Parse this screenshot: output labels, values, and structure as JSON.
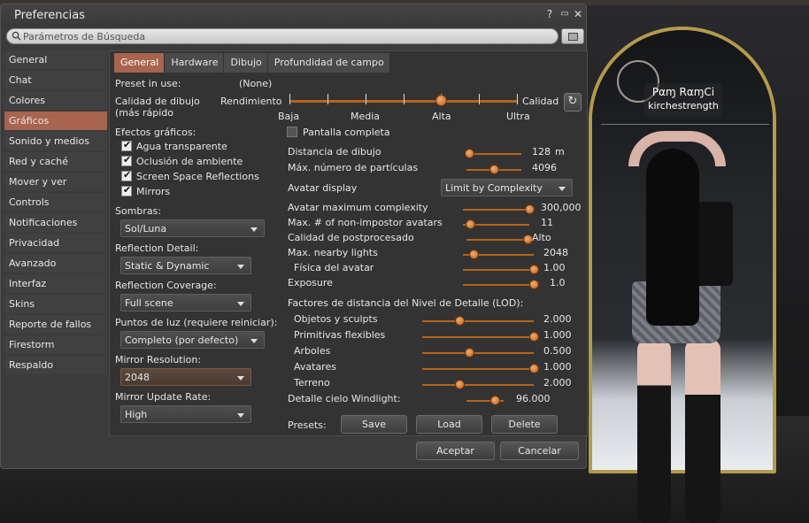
{
  "window": {
    "title": "Preferencias",
    "help_icon": "?",
    "minimize_icon": "▭",
    "close_icon": "✕"
  },
  "search": {
    "placeholder": "Parámetros de Búsqueda"
  },
  "sidebar": {
    "items": [
      {
        "label": "General"
      },
      {
        "label": "Chat"
      },
      {
        "label": "Colores"
      },
      {
        "label": "Gráficos"
      },
      {
        "label": "Sonido y medios"
      },
      {
        "label": "Red y caché"
      },
      {
        "label": "Mover y ver"
      },
      {
        "label": "Controls"
      },
      {
        "label": "Notificaciones"
      },
      {
        "label": "Privacidad"
      },
      {
        "label": "Avanzado"
      },
      {
        "label": "Interfaz"
      },
      {
        "label": "Skins"
      },
      {
        "label": "Reporte de fallos"
      },
      {
        "label": "Firestorm"
      },
      {
        "label": "Respaldo"
      }
    ],
    "active_index": 3
  },
  "tabs": [
    {
      "label": "General"
    },
    {
      "label": "Hardware"
    },
    {
      "label": "Dibujo"
    },
    {
      "label": "Profundidad de campo"
    }
  ],
  "general": {
    "preset_label": "Preset in use:",
    "preset_value": "(None)",
    "quality_label_1": "Calidad de dibujo",
    "quality_label_2": "(más rápido",
    "perf_label": "Rendimiento",
    "quality_end_label": "Calidad",
    "quality_ticks": {
      "t0": "Baja",
      "t1": "Media",
      "t2": "Alta",
      "t3": "Ultra"
    },
    "quality_level": 5,
    "quality_max": 7,
    "effects_label": "Efectos gráficos:",
    "checkboxes": [
      {
        "label": "Agua transparente",
        "checked": true
      },
      {
        "label": "Oclusión de ambiente",
        "checked": true
      },
      {
        "label": "Screen Space Reflections",
        "checked": true
      },
      {
        "label": "Mirrors",
        "checked": true
      }
    ],
    "fullscreen": {
      "label": "Pantalla completa",
      "checked": false
    },
    "shadows_label": "Sombras:",
    "shadows_value": "Sol/Luna",
    "reflection_detail_label": "Reflection Detail:",
    "reflection_detail_value": "Static & Dynamic",
    "reflection_coverage_label": "Reflection Coverage:",
    "reflection_coverage_value": "Full scene",
    "lights_label": "Puntos de luz (requiere reiniciar):",
    "lights_value": "Completo (por defecto)",
    "mirror_res_label": "Mirror Resolution:",
    "mirror_res_value": "2048",
    "mirror_rate_label": "Mirror Update Rate:",
    "mirror_rate_value": "High",
    "draw_distance": {
      "label": "Distancia de dibujo",
      "value": "128",
      "unit": "m",
      "fraction": 0.05
    },
    "max_particles": {
      "label": "Máx. número de partículas",
      "value": "4096",
      "fraction": 0.5
    },
    "avatar_display": {
      "label": "Avatar display",
      "value": "Limit by Complexity"
    },
    "avatar_complexity": {
      "label": "Avatar maximum complexity",
      "value": "300,000",
      "fraction": 1.0
    },
    "non_impostor": {
      "label": "Max. # of non-impostor avatars",
      "value": "11",
      "fraction": 0.1
    },
    "postprocess": {
      "label": "Calidad de postprocesado",
      "value": "Alto",
      "fraction": 1.0
    },
    "nearby_lights": {
      "label": "Max. nearby lights",
      "value": "2048",
      "fraction": 0.15
    },
    "avatar_physics": {
      "label": "Física del avatar",
      "value": "1.00",
      "fraction": 1.0
    },
    "exposure": {
      "label": "Exposure",
      "value": "1.0",
      "fraction": 1.0
    },
    "lod_label": "Factores de distancia del Nivel de Detalle (LOD):",
    "lod": [
      {
        "label": "Objetos y sculpts",
        "value": "2.000",
        "fraction": 0.33
      },
      {
        "label": "Primitivas flexibles",
        "value": "1.000",
        "fraction": 1.0
      },
      {
        "label": "Arboles",
        "value": "0.500",
        "fraction": 0.42
      },
      {
        "label": "Avatares",
        "value": "1.000",
        "fraction": 1.0
      },
      {
        "label": "Terreno",
        "value": "2.000",
        "fraction": 0.33
      }
    ],
    "windlight": {
      "label": "Detalle cielo Windlight:",
      "value": "96.000",
      "fraction": 0.77
    },
    "presets_label": "Presets:",
    "save_label": "Save",
    "load_label": "Load",
    "delete_label": "Delete"
  },
  "footer": {
    "ok_label": "Aceptar",
    "cancel_label": "Cancelar"
  },
  "nametag": {
    "name": "Pαɱ RαɱCi",
    "username": "kirchestrength"
  },
  "colors": {
    "accent": "#a8644e",
    "slider": "#b86318",
    "mirror_frame": "#b49a4e"
  }
}
